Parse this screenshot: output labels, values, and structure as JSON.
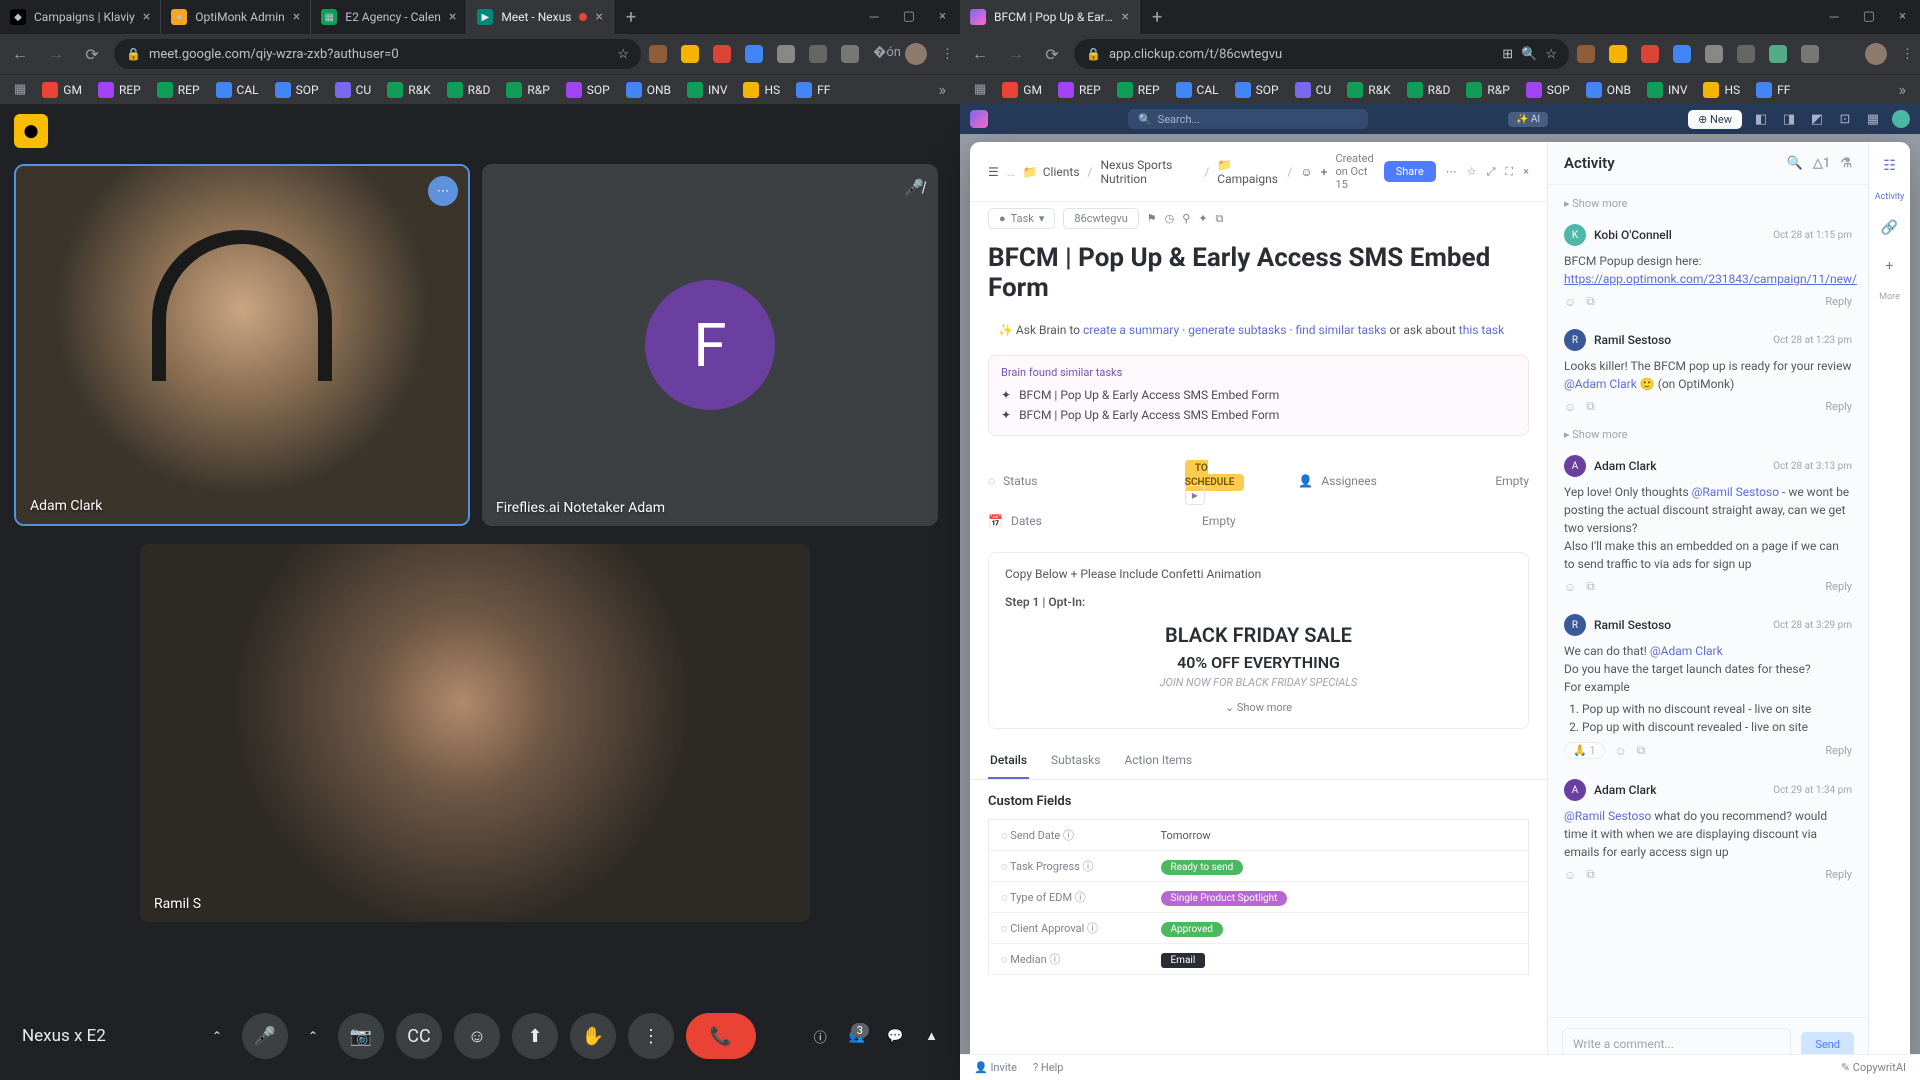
{
  "left_window": {
    "tabs": [
      {
        "title": "Campaigns | Klaviy",
        "active": false
      },
      {
        "title": "OptiMonk Admin",
        "active": false
      },
      {
        "title": "E2 Agency - Calen",
        "active": false
      },
      {
        "title": "Meet - Nexus",
        "active": true,
        "recording": true
      }
    ],
    "url": "meet.google.com/qiy-wzra-zxb?authuser=0"
  },
  "right_window": {
    "tabs": [
      {
        "title": "BFCM | Pop Up & Early Access",
        "active": true
      }
    ],
    "url": "app.clickup.com/t/86cwtegvu"
  },
  "bookmarks": [
    "GM",
    "REP",
    "REP",
    "CAL",
    "SOP",
    "CU",
    "R&K",
    "R&D",
    "R&P",
    "SOP",
    "ONB",
    "INV",
    "HS",
    "FF"
  ],
  "bookmark_colors": [
    "#ea4335",
    "#a142f4",
    "#0f9d58",
    "#4285f4",
    "#4285f4",
    "#7b68ee",
    "#0f9d58",
    "#0f9d58",
    "#0f9d58",
    "#a142f4",
    "#4285f4",
    "#0f9d58",
    "#f4b400",
    "#4285f4"
  ],
  "meet": {
    "title": "Nexus x E2",
    "tile1_name": "Adam Clark",
    "tile2_name": "Fireflies.ai Notetaker Adam",
    "tile2_initial": "F",
    "tile3_name": "Ramil S",
    "participant_count": "3"
  },
  "clickup": {
    "search_placeholder": "Search...",
    "ai_label": "✨ AI",
    "new_label": "⊕ New",
    "breadcrumb": [
      "Clients",
      "Nexus Sports Nutrition",
      "📁 Campaigns"
    ],
    "created": "Created on Oct 15",
    "share": "Share",
    "task_pill": "Task",
    "task_id": "86cwtegvu",
    "title": "BFCM | Pop Up & Early Access SMS Embed Form",
    "brain_prefix": "✨ Ask Brain to",
    "brain_links": [
      "create a summary",
      "generate subtasks",
      "find similar tasks"
    ],
    "brain_mid": "or ask about",
    "brain_end": "this task",
    "similar_header": "Brain found similar tasks",
    "similar": [
      "BFCM | Pop Up & Early Access SMS Embed Form",
      "BFCM | Pop Up & Early Access SMS Embed Form"
    ],
    "status_label": "Status",
    "status_value": "TO SCHEDULE",
    "assignees_label": "Assignees",
    "assignees_value": "Empty",
    "dates_label": "Dates",
    "dates_value": "Empty",
    "desc_note": "Copy Below + Please Include Confetti Animation",
    "desc_step": "Step 1 | Opt-In:",
    "desc_h1": "BLACK FRIDAY SALE",
    "desc_h2": "40% OFF EVERYTHING",
    "desc_sub": "JOIN NOW FOR BLACK FRIDAY SPECIALS",
    "show_more": "Show more",
    "tabs": [
      "Details",
      "Subtasks",
      "Action Items"
    ],
    "custom_title": "Custom Fields",
    "custom": [
      {
        "label": "Send Date",
        "value": "Tomorrow",
        "type": "text"
      },
      {
        "label": "Task Progress",
        "value": "Ready to send",
        "type": "green"
      },
      {
        "label": "Type of EDM",
        "value": "Single Product Spotlight",
        "type": "purple"
      },
      {
        "label": "Client Approval",
        "value": "Approved",
        "type": "green"
      },
      {
        "label": "Median",
        "value": "Email",
        "type": "dark"
      }
    ],
    "footer_invite": "Invite",
    "footer_help": "Help",
    "footer_copy": "CopywritAI"
  },
  "activity": {
    "title": "Activity",
    "rail_label": "Activity",
    "rail_more": "More",
    "show_more": "Show more",
    "comments": [
      {
        "author": "Kobi O'Connell",
        "avatar_bg": "#4db8a8",
        "initial": "K",
        "time": "Oct 28 at 1:15 pm",
        "body": "BFCM Popup design here:",
        "link": "https://app.optimonk.com/231843/campaign/11/new/"
      },
      {
        "author": "Ramil Sestoso",
        "avatar_bg": "#3b5998",
        "initial": "R",
        "time": "Oct 28 at 1:23 pm",
        "body": "Looks killer! The BFCM pop up is ready for your review ",
        "mention": "@Adam Clark",
        "suffix": " 🙂 (on OptiMonk)"
      },
      {
        "author": "Adam Clark",
        "avatar_bg": "#6b3fa0",
        "initial": "A",
        "time": "Oct 28 at 3:13 pm",
        "body": "Yep love! Only thoughts ",
        "mention": "@Ramil Sestoso",
        "suffix": " - we wont be posting the actual discount straight away, can we get two versions?",
        "body2": "Also I'll make this an embedded on a page if we can to send traffic to via ads for sign up"
      },
      {
        "author": "Ramil Sestoso",
        "avatar_bg": "#3b5998",
        "initial": "R",
        "time": "Oct 28 at 3:29 pm",
        "body": "We can do that! ",
        "mention": "@Adam Clark",
        "body2": "Do you have the target launch dates for these?",
        "body3": "For example",
        "list": [
          "Pop up with no discount reveal - live on site",
          "Pop up with discount revealed - live on site"
        ],
        "reaction": "🙏 1"
      },
      {
        "author": "Adam Clark",
        "avatar_bg": "#6b3fa0",
        "initial": "A",
        "time": "Oct 29 at 1:34 pm",
        "mention": "@Ramil Sestoso",
        "suffix": " what do you recommend? would time it with when we are displaying discount via emails for early access sign up"
      }
    ],
    "reply": "Reply",
    "comment_placeholder": "Write a comment...",
    "send": "Send"
  }
}
